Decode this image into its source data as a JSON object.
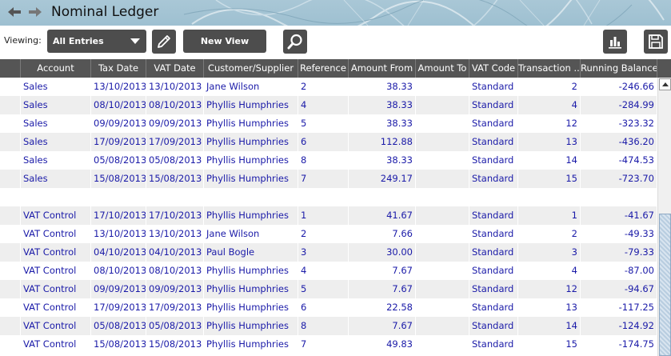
{
  "window": {
    "title": "Nominal Ledger",
    "back_icon": "back-arrow-icon",
    "forward_icon": "forward-arrow-icon"
  },
  "toolbar": {
    "viewing_label": "Viewing:",
    "view_select_value": "All Entries",
    "edit_icon": "pencil-icon",
    "new_view_label": "New View",
    "search_icon": "search-icon",
    "chart_icon": "bar-chart-icon",
    "save_icon": "save-disk-icon",
    "button_color": "#4d4d4d"
  },
  "table": {
    "columns": [
      "",
      "Account",
      "Tax Date",
      "VAT Date",
      "Customer/Supplier",
      "Reference",
      "Amount From",
      "Amount To",
      "VAT Code",
      "Transaction ...",
      "Running Balance"
    ],
    "rows": [
      {
        "account": "Sales",
        "tax_date": "13/10/2013",
        "vat_date": "13/10/2013",
        "party": "Jane Wilson",
        "reference": "2",
        "amount_from": "38.33",
        "amount_to": "",
        "vat_code": "Standard",
        "transaction": "2",
        "balance": "-246.66"
      },
      {
        "account": "Sales",
        "tax_date": "08/10/2013",
        "vat_date": "08/10/2013",
        "party": "Phyllis Humphries",
        "reference": "4",
        "amount_from": "38.33",
        "amount_to": "",
        "vat_code": "Standard",
        "transaction": "4",
        "balance": "-284.99"
      },
      {
        "account": "Sales",
        "tax_date": "09/09/2013",
        "vat_date": "09/09/2013",
        "party": "Phyllis Humphries",
        "reference": "5",
        "amount_from": "38.33",
        "amount_to": "",
        "vat_code": "Standard",
        "transaction": "12",
        "balance": "-323.32"
      },
      {
        "account": "Sales",
        "tax_date": "17/09/2013",
        "vat_date": "17/09/2013",
        "party": "Phyllis Humphries",
        "reference": "6",
        "amount_from": "112.88",
        "amount_to": "",
        "vat_code": "Standard",
        "transaction": "13",
        "balance": "-436.20"
      },
      {
        "account": "Sales",
        "tax_date": "05/08/2013",
        "vat_date": "05/08/2013",
        "party": "Phyllis Humphries",
        "reference": "8",
        "amount_from": "38.33",
        "amount_to": "",
        "vat_code": "Standard",
        "transaction": "14",
        "balance": "-474.53"
      },
      {
        "account": "Sales",
        "tax_date": "15/08/2013",
        "vat_date": "15/08/2013",
        "party": "Phyllis Humphries",
        "reference": "7",
        "amount_from": "249.17",
        "amount_to": "",
        "vat_code": "Standard",
        "transaction": "15",
        "balance": "-723.70"
      },
      {
        "account": "",
        "tax_date": "",
        "vat_date": "",
        "party": "",
        "reference": "",
        "amount_from": "",
        "amount_to": "",
        "vat_code": "",
        "transaction": "",
        "balance": ""
      },
      {
        "account": "VAT Control",
        "tax_date": "17/10/2013",
        "vat_date": "17/10/2013",
        "party": "Phyllis Humphries",
        "reference": "1",
        "amount_from": "41.67",
        "amount_to": "",
        "vat_code": "Standard",
        "transaction": "1",
        "balance": "-41.67"
      },
      {
        "account": "VAT Control",
        "tax_date": "13/10/2013",
        "vat_date": "13/10/2013",
        "party": "Jane Wilson",
        "reference": "2",
        "amount_from": "7.66",
        "amount_to": "",
        "vat_code": "Standard",
        "transaction": "2",
        "balance": "-49.33"
      },
      {
        "account": "VAT Control",
        "tax_date": "04/10/2013",
        "vat_date": "04/10/2013",
        "party": "Paul Bogle",
        "reference": "3",
        "amount_from": "30.00",
        "amount_to": "",
        "vat_code": "Standard",
        "transaction": "3",
        "balance": "-79.33"
      },
      {
        "account": "VAT Control",
        "tax_date": "08/10/2013",
        "vat_date": "08/10/2013",
        "party": "Phyllis Humphries",
        "reference": "4",
        "amount_from": "7.67",
        "amount_to": "",
        "vat_code": "Standard",
        "transaction": "4",
        "balance": "-87.00"
      },
      {
        "account": "VAT Control",
        "tax_date": "09/09/2013",
        "vat_date": "09/09/2013",
        "party": "Phyllis Humphries",
        "reference": "5",
        "amount_from": "7.67",
        "amount_to": "",
        "vat_code": "Standard",
        "transaction": "12",
        "balance": "-94.67"
      },
      {
        "account": "VAT Control",
        "tax_date": "17/09/2013",
        "vat_date": "17/09/2013",
        "party": "Phyllis Humphries",
        "reference": "6",
        "amount_from": "22.58",
        "amount_to": "",
        "vat_code": "Standard",
        "transaction": "13",
        "balance": "-117.25"
      },
      {
        "account": "VAT Control",
        "tax_date": "05/08/2013",
        "vat_date": "05/08/2013",
        "party": "Phyllis Humphries",
        "reference": "8",
        "amount_from": "7.67",
        "amount_to": "",
        "vat_code": "Standard",
        "transaction": "14",
        "balance": "-124.92"
      },
      {
        "account": "VAT Control",
        "tax_date": "15/08/2013",
        "vat_date": "15/08/2013",
        "party": "Phyllis Humphries",
        "reference": "7",
        "amount_from": "49.83",
        "amount_to": "",
        "vat_code": "Standard",
        "transaction": "15",
        "balance": "-174.75"
      }
    ]
  }
}
